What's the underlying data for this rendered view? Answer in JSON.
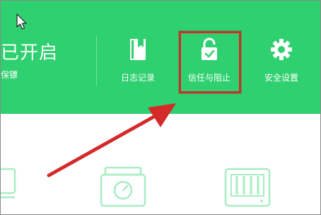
{
  "header": {
    "status_title": "已开启",
    "status_subtitle": "保镖"
  },
  "nav": {
    "items": [
      {
        "label": "日志记录",
        "icon": "log-book-icon"
      },
      {
        "label": "信任与阻止",
        "icon": "unlocked-lock-check-icon"
      },
      {
        "label": "安全设置",
        "icon": "gear-icon"
      }
    ]
  },
  "annotation": {
    "highlight": "red-box",
    "pointer": "red-arrow"
  },
  "features": {
    "icons": [
      "monitor-icon",
      "usb-device-icon",
      "drive-icon"
    ]
  },
  "colors": {
    "header_bg": "#2fd06f",
    "accent_red": "#d42a2a",
    "icon_outline": "#a8ecc3"
  }
}
